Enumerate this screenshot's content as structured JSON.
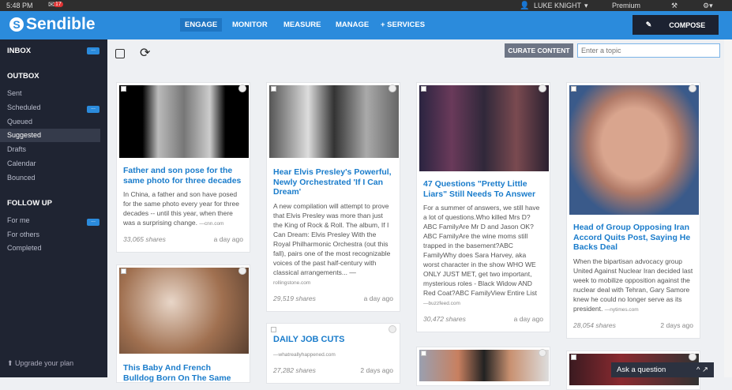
{
  "system": {
    "time": "5:48 PM",
    "notifications": "17",
    "user": "LUKE KNIGHT",
    "plan": "Premium"
  },
  "header": {
    "logo": "Sendible",
    "nav": [
      "ENGAGE",
      "MONITOR",
      "MEASURE",
      "MANAGE",
      "+ SERVICES"
    ],
    "compose": "COMPOSE"
  },
  "sidebar": {
    "inbox": "INBOX",
    "outbox": "OUTBOX",
    "outbox_items": [
      "Sent",
      "Scheduled",
      "Queued",
      "Suggested",
      "Drafts",
      "Calendar",
      "Bounced"
    ],
    "followup": "FOLLOW UP",
    "followup_items": [
      "For me",
      "For others",
      "Completed"
    ],
    "more": "...",
    "upgrade": "Upgrade your plan"
  },
  "toolbar": {
    "curate": "CURATE CONTENT",
    "topic_placeholder": "Enter a topic"
  },
  "cards": [
    {
      "title": "Father and son pose for the same photo for three decades",
      "desc": "In China, a father and son have posed for the same photo every year for three decades -- until this year, when there was a surprising change.",
      "source": "—cnn.com",
      "shares": "33,065 shares",
      "time": "a day ago"
    },
    {
      "title": "Hear Elvis Presley's Powerful, Newly Orchestrated 'If I Can Dream'",
      "desc": "A new compilation will attempt to prove that Elvis Presley was more than just the King of Rock & Roll. The album, If I Can Dream: Elvis Presley With the Royal Philharmonic Orchestra (out this fall), pairs one of the most recognizable voices of the past half-century with classical arrangements... —",
      "source": "rollingstone.com",
      "shares": "29,519 shares",
      "time": "a day ago"
    },
    {
      "title": "47 Questions \"Pretty Little Liars\" Still Needs To Answer",
      "desc": "For a summer of answers, we still have a lot of questions.Who killed Mrs D? ABC FamilyAre Mr D and Jason OK? ABC FamilyAre the wine moms still trapped in the basement?ABC FamilyWhy does Sara Harvey, aka worst character in the show WHO WE ONLY JUST MET, get two important, mysterious roles - Black Widow AND Red Coat?ABC FamilyView Entire List",
      "source": "—buzzfeed.com",
      "shares": "30,472 shares",
      "time": "a day ago"
    },
    {
      "title": "Head of Group Opposing Iran Accord Quits Post, Saying He Backs Deal",
      "desc": "When the bipartisan advocacy group United Against Nuclear Iran decided last week to mobilize opposition against the nuclear deal with Tehran, Gary Samore knew he could no longer serve as its president.",
      "source": "—nytimes.com",
      "shares": "28,054 shares",
      "time": "2 days ago"
    },
    {
      "title": "This Baby And French Bulldog Born On The Same"
    },
    {
      "title": "DAILY JOB CUTS",
      "source": "—whatreallyhappened.com",
      "shares": "27,282 shares",
      "time": "2 days ago"
    }
  ],
  "chat": {
    "label": "Ask a question"
  }
}
